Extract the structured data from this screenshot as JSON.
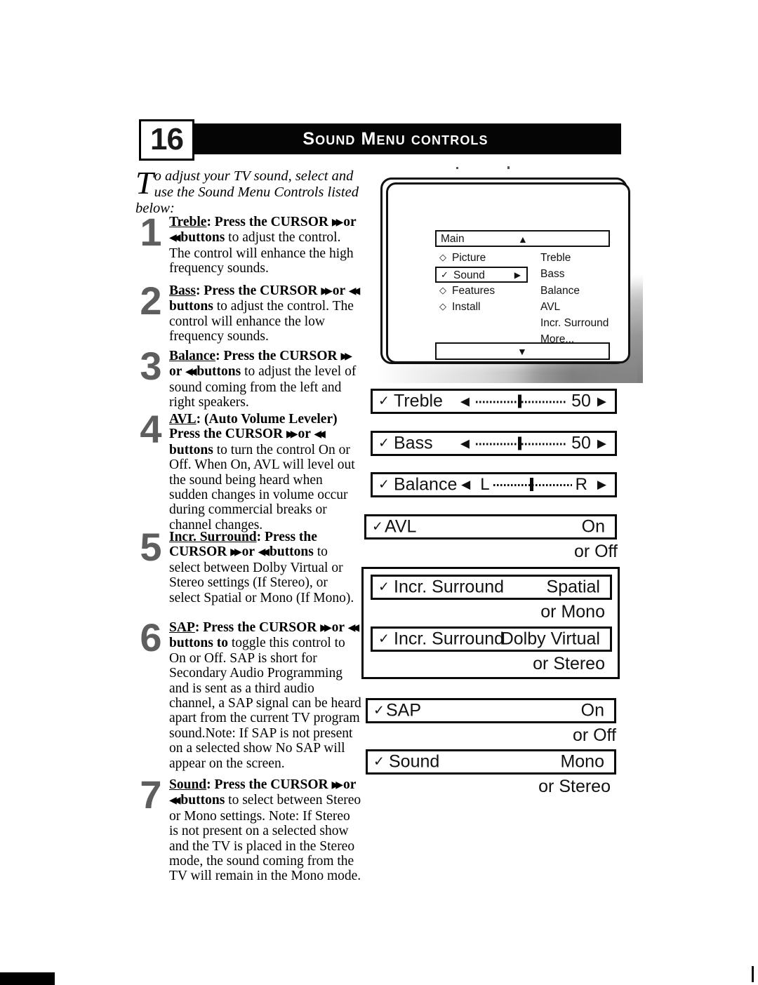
{
  "header": {
    "page_number": "16",
    "title": "Sound Menu controls"
  },
  "intro": {
    "dropcap": "T",
    "text": "o adjust your TV sound, select and use the Sound Menu Controls listed below:"
  },
  "steps": [
    {
      "num": "1",
      "term": "Treble",
      "text_bold_a": ": Press the CURSOR ",
      "text_bold_b": " or ",
      "text_bold_c": " buttons ",
      "text_rest": "to adjust the control. The control will enhance the high frequency sounds."
    },
    {
      "num": "2",
      "term": "Bass",
      "text_bold_a": ": Press the CURSOR ",
      "text_bold_b": " or ",
      "text_bold_c": " buttons ",
      "text_rest": "to adjust the control. The control will enhance the low frequency sounds."
    },
    {
      "num": "3",
      "term": "Balance",
      "text_bold_a": ": Press the CURSOR ",
      "text_bold_b": " or ",
      "text_bold_c": " buttons ",
      "text_rest": "to adjust the level of sound coming from the left and right speakers."
    },
    {
      "num": "4",
      "term": "AVL",
      "text_bold_a": ":  (Auto Volume Leveler) Press the CURSOR ",
      "text_bold_b": " or ",
      "text_bold_c": " buttons ",
      "text_rest": "to turn the control On or Off. When On, AVL will level out the sound being heard when sudden changes in volume occur during commercial breaks or channel changes."
    },
    {
      "num": "5",
      "term": "Incr. Surround",
      "text_bold_a": ": Press the CURSOR ",
      "text_bold_b": " or ",
      "text_bold_c": " buttons ",
      "text_rest": "to select between Dolby Virtual or Stereo settings (If Stereo), or select Spatial or Mono (If Mono)."
    },
    {
      "num": "6",
      "term": "SAP",
      "text_bold_a": ": Press the CURSOR ",
      "text_bold_b": " or ",
      "text_bold_c": " buttons to ",
      "text_rest": "toggle this control to On or Off.  SAP is short for Secondary Audio Programming and is sent as a third audio channel, a SAP signal can be heard apart from the current TV program sound.Note: If SAP is not present on a selected show No SAP will appear on the screen."
    },
    {
      "num": "7",
      "term": "Sound",
      "text_bold_a": ": Press the CURSOR ",
      "text_bold_b": " or ",
      "text_bold_c": " buttons ",
      "text_rest": "to select between Stereo or Mono settings. Note: If Stereo is not present on a selected show and the TV is placed in the Stereo mode, the sound coming from the TV will remain in the Mono mode."
    }
  ],
  "tv_menu": {
    "header_label": "Main",
    "up_arrow": "▲",
    "down_arrow": "▼",
    "left_items": [
      {
        "mark": "◇",
        "label": "Picture",
        "selected": false
      },
      {
        "mark": "✓",
        "label": "Sound",
        "selected": true,
        "right_arrow": "▶"
      },
      {
        "mark": "◇",
        "label": "Features",
        "selected": false
      },
      {
        "mark": "◇",
        "label": "Install",
        "selected": false
      }
    ],
    "right_items": [
      "Treble",
      "Bass",
      "Balance",
      "AVL",
      "Incr. Surround",
      "More..."
    ]
  },
  "osd_bars": {
    "treble": {
      "check": "✓",
      "name": "Treble",
      "value": "50",
      "type": "slider",
      "knob_pct": 50
    },
    "bass": {
      "check": "✓",
      "name": "Bass",
      "value": "50",
      "type": "slider",
      "knob_pct": 50
    },
    "balance": {
      "check": "✓",
      "name": "Balance",
      "left_label": "L",
      "right_label": "R",
      "type": "balance",
      "knob_pct": 50
    },
    "avl": {
      "check": "✓",
      "name": "AVL",
      "value": "On",
      "suffix": "or Off"
    },
    "surround_a": {
      "check": "✓",
      "name": "Incr. Surround",
      "value": "Spatial",
      "suffix": "or Mono"
    },
    "surround_b": {
      "check": "✓",
      "name": "Incr. Surround",
      "value": "Dolby Virtual",
      "suffix": "or Stereo"
    },
    "sap": {
      "check": "✓",
      "name": "SAP",
      "value": "On",
      "suffix": "or Off"
    },
    "sound": {
      "check": "✓",
      "name": "Sound",
      "value": "Mono",
      "suffix": "or Stereo"
    }
  },
  "arrows": {
    "forward": "▶▶",
    "backward": "◀◀",
    "tri_left": "◀",
    "tri_right": "▶"
  }
}
